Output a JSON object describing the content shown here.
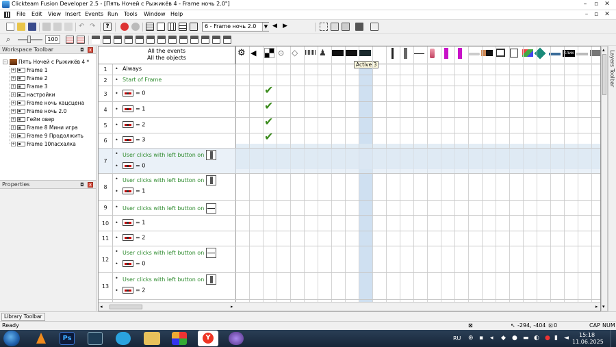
{
  "window": {
    "title": "Clickteam Fusion Developer 2.5 - [Пять Ночей с Рыжикёв 4 - Frame ночь 2.0\"]"
  },
  "menu": [
    "File",
    "Edit",
    "View",
    "Insert",
    "Events",
    "Run",
    "Tools",
    "Window",
    "Help"
  ],
  "toolbar": {
    "frame_select": "6 - Frame ночь 2.0",
    "zoom_value": "100"
  },
  "workspace": {
    "title": "Workspace Toolbar",
    "app_name": "Пять Ночей с Рыжикёв 4 *",
    "frames": [
      "Frame 1",
      "Frame 2",
      "Frame 3",
      "настройки",
      "Frame ночь кацсцена",
      "Frame ночь 2.0",
      "Гейм овер",
      "Frame 8 Мини игра",
      "Frame 9 Продолжить",
      "Frame 10пасхалка"
    ]
  },
  "properties": {
    "title": "Properties"
  },
  "layers": {
    "title": "Layers Toolbar"
  },
  "library": {
    "title": "Library Toolbar"
  },
  "editor": {
    "header_line1": "All the events",
    "header_line2": "All the objects",
    "tooltip": "Active 3",
    "header_labels": {
      "klik": "Клик"
    },
    "rows": [
      {
        "num": "1",
        "conds": [
          {
            "text": "Always",
            "type": "plain"
          }
        ]
      },
      {
        "num": "2",
        "conds": [
          {
            "text": "Start of Frame",
            "type": "green"
          }
        ]
      },
      {
        "num": "3",
        "conds": [
          {
            "text": "= 0",
            "type": "counter"
          }
        ]
      },
      {
        "num": "4",
        "conds": [
          {
            "text": "= 1",
            "type": "counter"
          }
        ]
      },
      {
        "num": "5",
        "conds": [
          {
            "text": "= 2",
            "type": "counter"
          }
        ]
      },
      {
        "num": "6",
        "conds": [
          {
            "text": "= 3",
            "type": "counter"
          }
        ]
      },
      {
        "num": "7",
        "conds": [
          {
            "text": "User clicks with left button on",
            "type": "click"
          },
          {
            "text": "= 0",
            "type": "counter"
          }
        ]
      },
      {
        "num": "8",
        "conds": [
          {
            "text": "User clicks with left button on",
            "type": "click"
          },
          {
            "text": "= 1",
            "type": "counter"
          }
        ]
      },
      {
        "num": "9",
        "conds": [
          {
            "text": "User clicks with left button on",
            "type": "click"
          }
        ]
      },
      {
        "num": "10",
        "conds": [
          {
            "text": "= 1",
            "type": "counter"
          }
        ]
      },
      {
        "num": "11",
        "conds": [
          {
            "text": "= 2",
            "type": "counter"
          }
        ]
      },
      {
        "num": "12",
        "conds": [
          {
            "text": "User clicks with left button on",
            "type": "click"
          },
          {
            "text": "= 0",
            "type": "counter"
          }
        ]
      },
      {
        "num": "13",
        "conds": [
          {
            "text": "User clicks with left button on",
            "type": "click"
          },
          {
            "text": "= 2",
            "type": "counter"
          }
        ]
      }
    ]
  },
  "status": {
    "ready": "Ready",
    "coords": "-294, -404",
    "objcount": "0",
    "cap": "CAP",
    "num": "NUM"
  },
  "taskbar": {
    "lang": "RU",
    "time": "15:18",
    "date": "11.06.2025"
  },
  "colors": {
    "selected_row": "#dce8f3",
    "highlight_col": "#cfe0f1",
    "green_text": "#2e8b2e",
    "check": "#3c8c1e"
  }
}
